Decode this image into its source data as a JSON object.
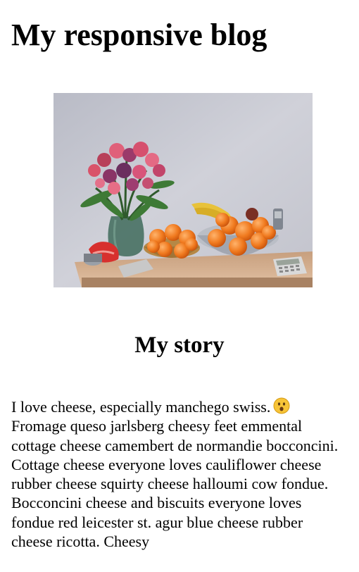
{
  "page": {
    "title": "My responsive blog"
  },
  "image": {
    "alt": "Still life photo of a vase of pink flowers and bowls of oranges and bananas on a table"
  },
  "story": {
    "heading": "My story",
    "text_before_emoji": "I love cheese, especially manchego swiss.",
    "emoji": "surprised-face",
    "text_after_emoji": "Fromage queso jarlsberg cheesy feet emmental cottage cheese camembert de normandie bocconcini. Cottage cheese everyone loves cauliflower cheese rubber cheese squirty cheese halloumi cow fondue. Bocconcini cheese and biscuits everyone loves fondue red leicester st. agur blue cheese rubber cheese ricotta. Cheesy"
  }
}
